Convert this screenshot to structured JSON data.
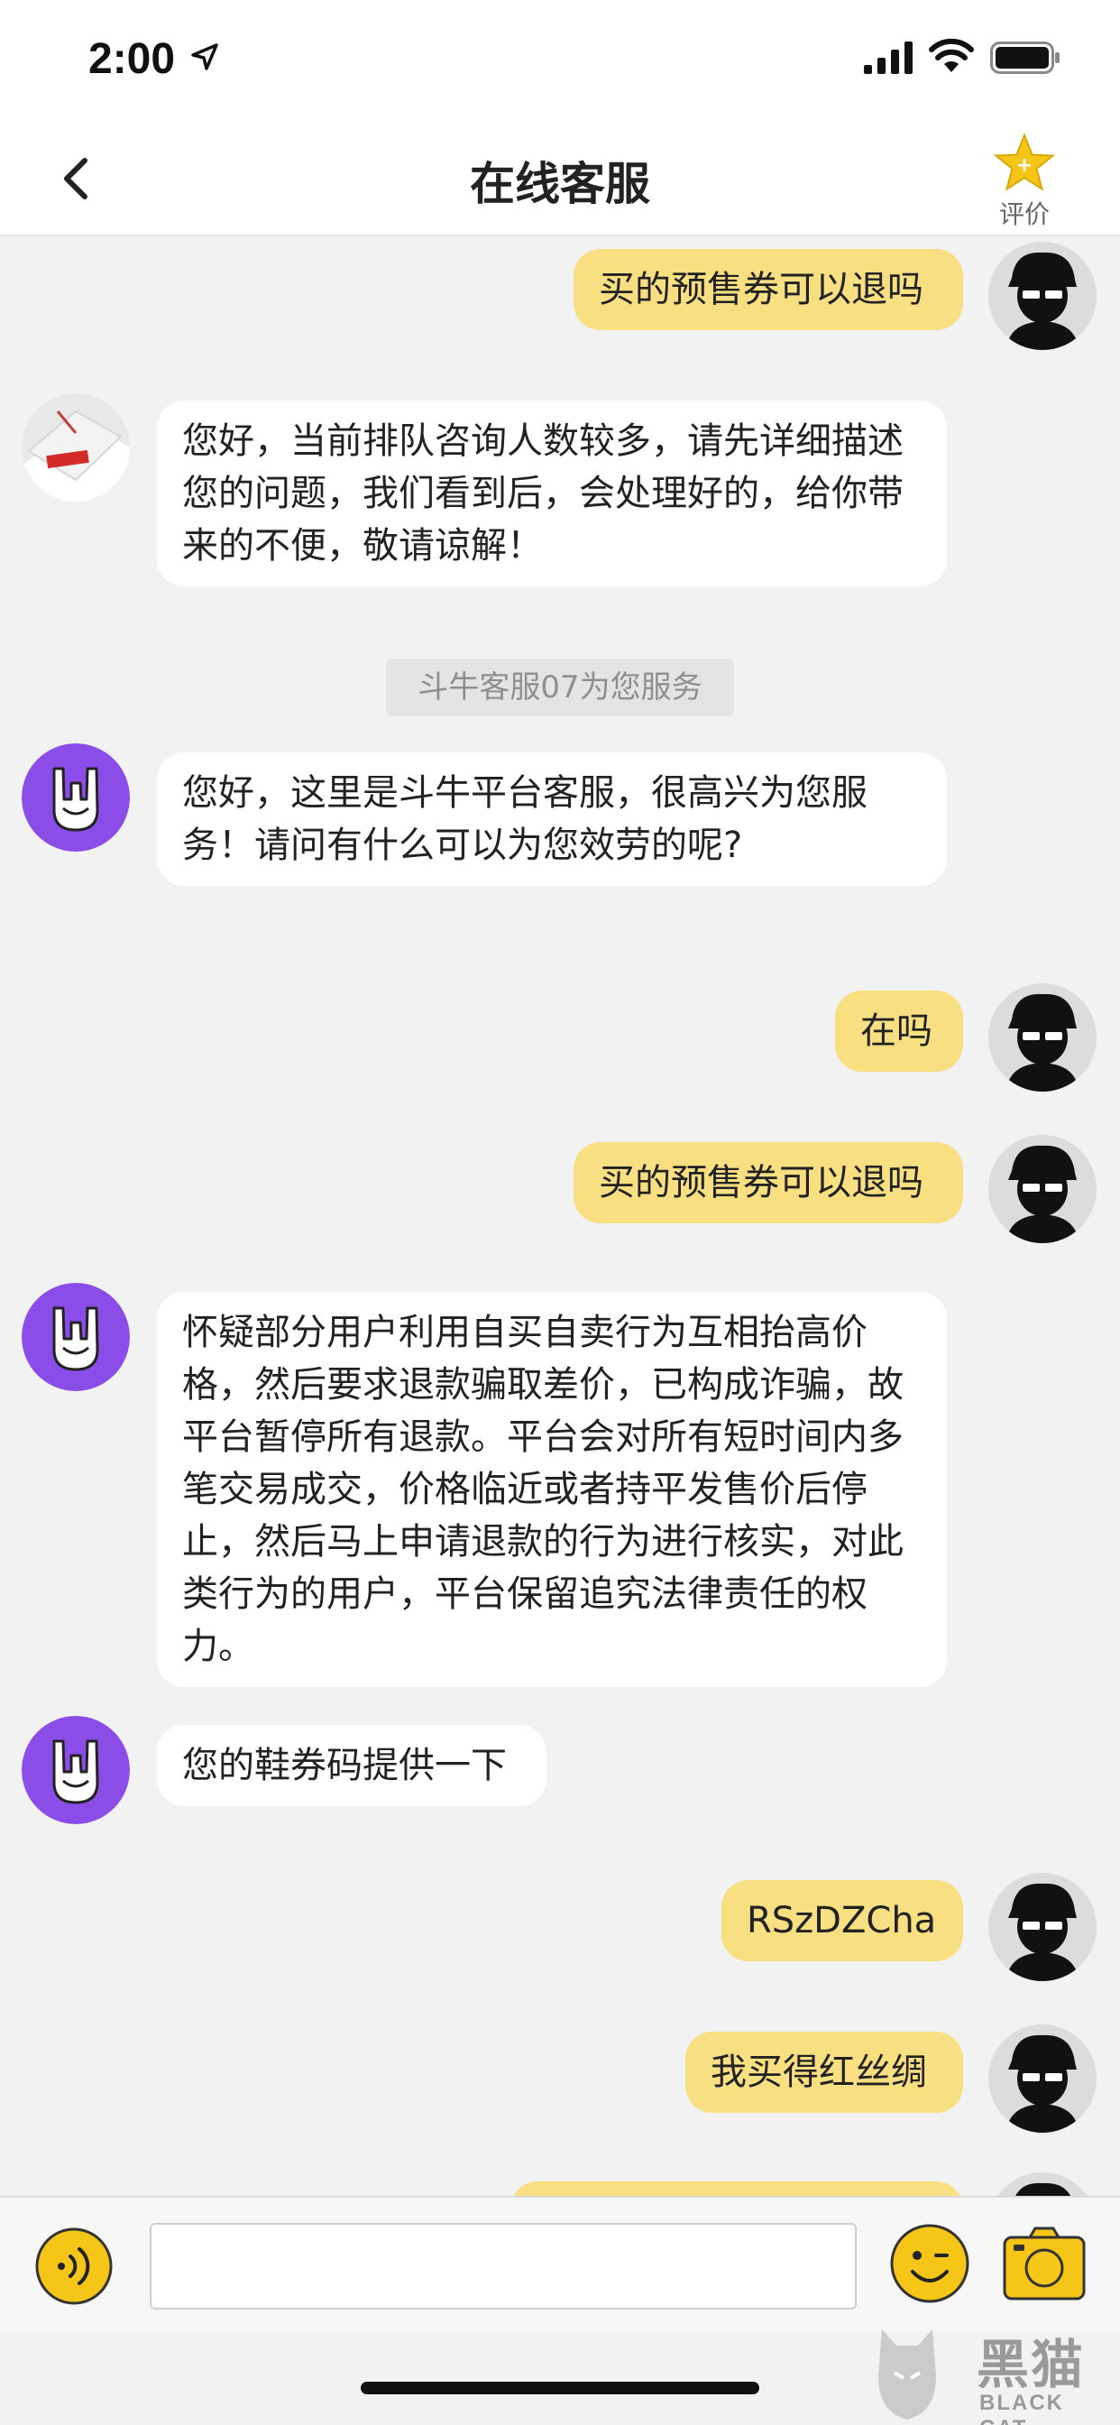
{
  "status_bar": {
    "time": "2:00"
  },
  "nav": {
    "title": "在线客服",
    "rate_label": "评价"
  },
  "messages": [
    {
      "text": "买的预售券可以退吗"
    },
    {
      "text": "您好，当前排队咨询人数较多，请先详细描述您的问题，我们看到后，会处理好的，给你带来的不便，敬请谅解！"
    },
    {
      "text": "斗牛客服07为您服务"
    },
    {
      "text": "您好，这里是斗牛平台客服，很高兴为您服务！请问有什么可以为您效劳的呢?"
    },
    {
      "text": "在吗"
    },
    {
      "text": "买的预售券可以退吗"
    },
    {
      "text": "怀疑部分用户利用自买自卖行为互相抬高价格，然后要求退款骗取差价，已构成诈骗，故平台暂停所有退款。平台会对所有短时间内多笔交易成交，价格临近或者持平发售价后停止，然后马上申请退款的行为进行核实，对此类行为的用户，平台保留追究法律责任的权力。"
    },
    {
      "text": "您的鞋券码提供一下"
    },
    {
      "text": "RSzDZCha"
    },
    {
      "text": "我买得红丝绸"
    }
  ],
  "input": {
    "value": "",
    "placeholder": ""
  },
  "watermark": {
    "brand": "黑猫",
    "sub": "BLACK CAT"
  },
  "colors": {
    "user_bubble": "#f7df82",
    "agent_bubble": "#ffffff",
    "accent": "#f5c518",
    "agent_avatar": "#8a4de8"
  }
}
